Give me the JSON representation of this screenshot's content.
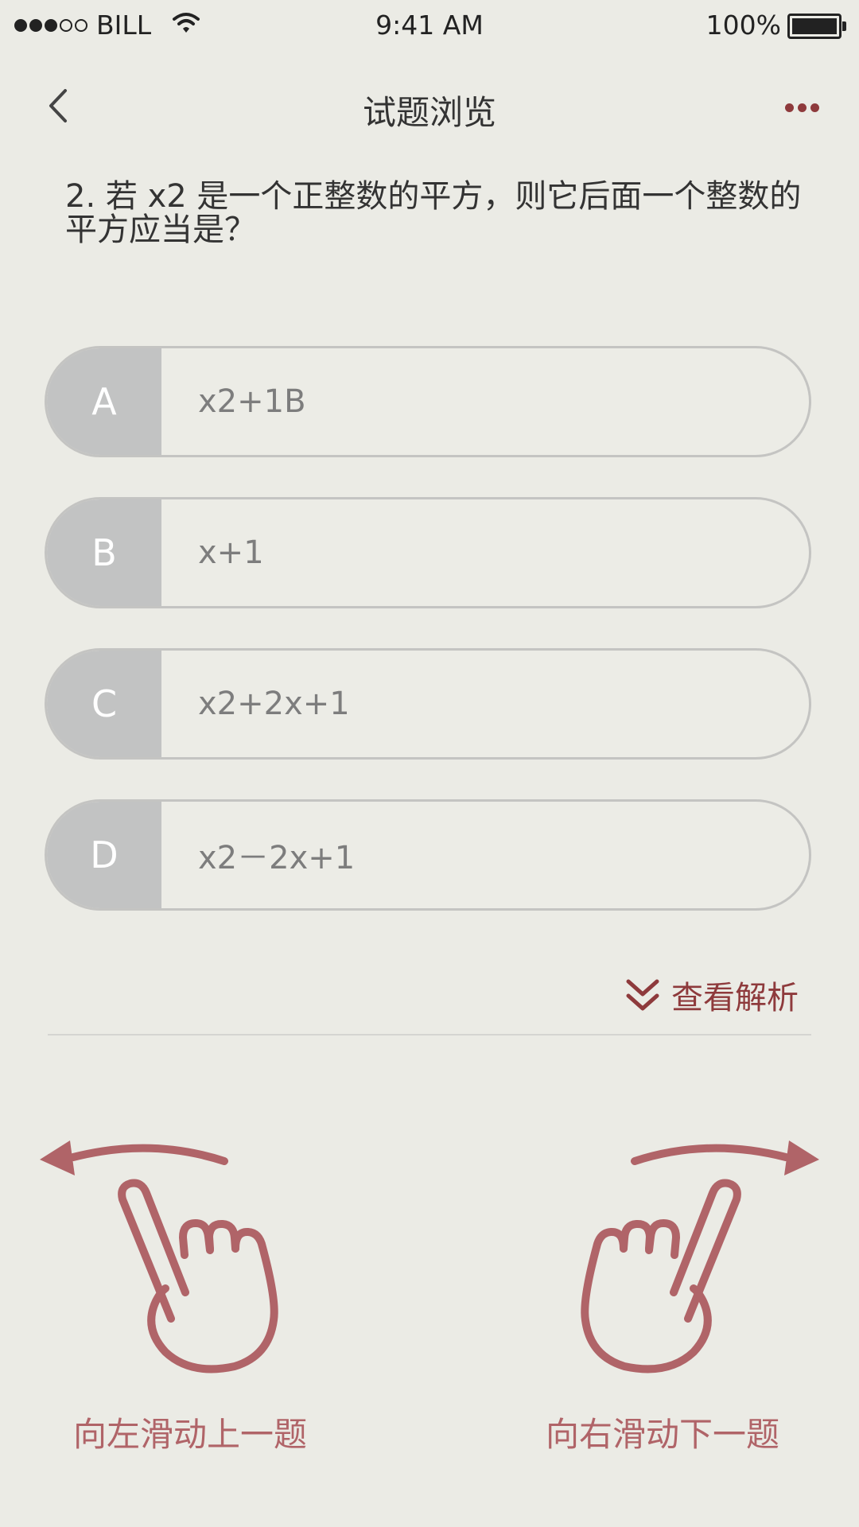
{
  "status_bar": {
    "carrier": "BILL",
    "time": "9:41 AM",
    "battery": "100%"
  },
  "nav": {
    "title": "试题浏览",
    "back_icon": "chevron-left-icon",
    "more_icon": "more-dots-icon"
  },
  "question": {
    "text": "2. 若 x2 是一个正整数的平方，则它后面一个整数的平方应当是？"
  },
  "options": [
    {
      "letter": "A",
      "text": "x2+1B"
    },
    {
      "letter": "B",
      "text": "x+1"
    },
    {
      "letter": "C",
      "text": "x2+2x+1"
    },
    {
      "letter": "D",
      "text": "x2－2x+1"
    }
  ],
  "analysis": {
    "label": "查看解析",
    "icon": "double-chevron-down-icon"
  },
  "hints": {
    "prev": "向左滑动上一题",
    "next": "向右滑动下一题"
  },
  "colors": {
    "accent": "#8e3a3c",
    "hint": "#b06468",
    "background": "#ebebe5",
    "option_letter_bg": "#c2c3c3"
  }
}
